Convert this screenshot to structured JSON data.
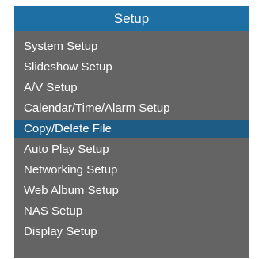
{
  "window": {
    "title": "Setup"
  },
  "menu": {
    "selected_index": 5,
    "items": [
      {
        "label": "System Setup"
      },
      {
        "label": "Slideshow Setup"
      },
      {
        "label": "A/V Setup"
      },
      {
        "label": "Calendar/Time/Alarm Setup"
      },
      {
        "label": "Copy/Delete File"
      },
      {
        "label": "Auto Play Setup"
      },
      {
        "label": "Networking Setup"
      },
      {
        "label": "Web Album Setup"
      },
      {
        "label": "NAS Setup"
      },
      {
        "label": "Display Setup"
      }
    ]
  },
  "colors": {
    "title_bar": "#1e6fa4",
    "panel_background": "#646464",
    "selection_highlight": "#1e5c86",
    "text": "#ffffff"
  }
}
